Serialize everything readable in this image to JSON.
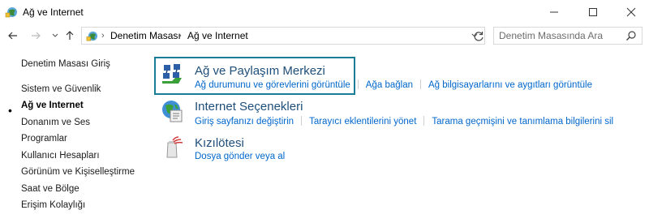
{
  "window": {
    "title": "Ağ ve Internet",
    "min_label": "—",
    "max_label": "☐",
    "close_label": "✕"
  },
  "nav": {
    "breadcrumb": [
      "Denetim Masası",
      "Ağ ve Internet"
    ],
    "search_placeholder": "Denetim Masasında Ara"
  },
  "sidebar": {
    "items": [
      {
        "label": "Denetim Masası Giriş",
        "active": false
      },
      {
        "label": "Sistem ve Güvenlik",
        "active": false
      },
      {
        "label": "Ağ ve Internet",
        "active": true
      },
      {
        "label": "Donanım ve Ses",
        "active": false
      },
      {
        "label": "Programlar",
        "active": false
      },
      {
        "label": "Kullanıcı Hesapları",
        "active": false
      },
      {
        "label": "Görünüm ve Kişiselleştirme",
        "active": false
      },
      {
        "label": "Saat ve Bölge",
        "active": false
      },
      {
        "label": "Erişim Kolaylığı",
        "active": false
      }
    ]
  },
  "categories": [
    {
      "title": "Ağ ve Paylaşım Merkezi",
      "icon": "network-sharing-icon",
      "links": [
        "Ağ durumunu ve görevlerini görüntüle",
        "Ağa bağlan",
        "Ağ bilgisayarlarını ve aygıtları görüntüle"
      ]
    },
    {
      "title": "Internet Seçenekleri",
      "icon": "internet-options-icon",
      "links": [
        "Giriş sayfanızı değiştirin",
        "Tarayıcı eklentilerini yönet",
        "Tarama geçmişini ve tanımlama bilgilerini sil"
      ]
    },
    {
      "title": "Kızılötesi",
      "icon": "infrared-icon",
      "links": [
        "Dosya gönder veya al"
      ]
    }
  ],
  "colors": {
    "link": "#0066cc",
    "heading": "#1e4e79",
    "highlight_border": "#1b7c95"
  }
}
